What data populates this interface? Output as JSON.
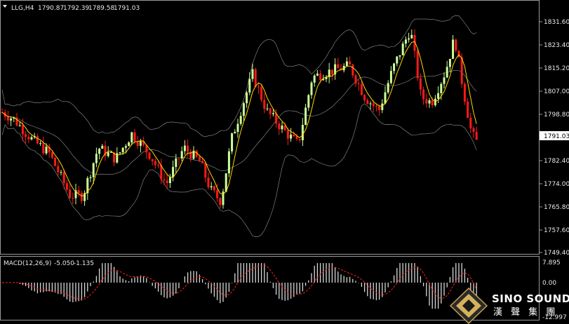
{
  "header": {
    "symbol": "LLG,H4",
    "open": "1790.87",
    "high": "1792.39",
    "low": "1789.58",
    "close": "1791.03"
  },
  "price_axis": {
    "ticks": [
      "1831.60",
      "1823.40",
      "1815.20",
      "1807.00",
      "1798.80",
      "1782.40",
      "1774.00",
      "1765.80",
      "1757.60",
      "1749.40"
    ],
    "current_price": "1791.03"
  },
  "macd": {
    "label": "MACD(12,26,9)",
    "main": "-5.050",
    "signal": "-1.135",
    "ticks": [
      "7.895",
      "0.00",
      "-12.997"
    ]
  },
  "logo": {
    "name": "SINO SOUND",
    "chinese": "漢 聲 集 團"
  },
  "colors": {
    "background": "#000000",
    "bull_candle": "#ccff99",
    "bear_candle": "#ff1a1a",
    "bollinger": "#c8c8c8",
    "moving_average": "#ffd700",
    "macd_histogram": "#d8d8d8",
    "macd_signal": "#ff2020"
  },
  "icons": {
    "dropdown": "triangle-down-icon",
    "logo": "diamond-logo-icon"
  }
}
